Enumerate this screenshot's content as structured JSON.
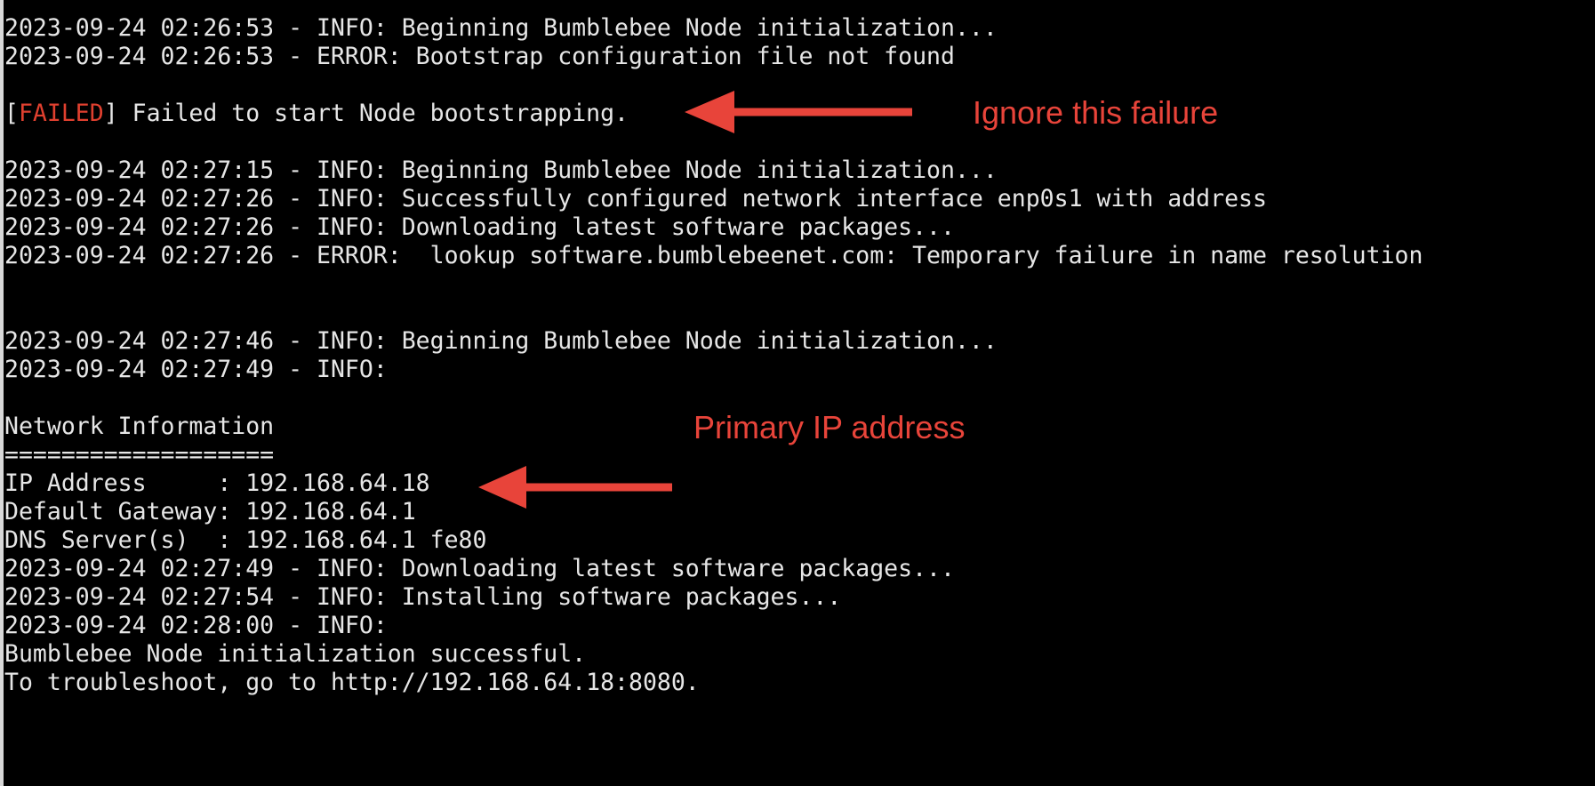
{
  "terminal": {
    "lines": [
      "2023-09-24 02:26:53 - INFO: Beginning Bumblebee Node initialization...",
      "2023-09-24 02:26:53 - ERROR: Bootstrap configuration file not found",
      "",
      "[FAILED] Failed to start Node bootstrapping.",
      "",
      "2023-09-24 02:27:15 - INFO: Beginning Bumblebee Node initialization...",
      "2023-09-24 02:27:26 - INFO: Successfully configured network interface enp0s1 with address",
      "2023-09-24 02:27:26 - INFO: Downloading latest software packages...",
      "2023-09-24 02:27:26 - ERROR:  lookup software.bumblebeenet.com: Temporary failure in name resolution",
      "",
      "",
      "2023-09-24 02:27:46 - INFO: Beginning Bumblebee Node initialization...",
      "2023-09-24 02:27:49 - INFO:",
      "",
      "Network Information",
      "===================",
      "IP Address     : 192.168.64.18",
      "Default Gateway: 192.168.64.1",
      "DNS Server(s)  : 192.168.64.1 fe80",
      "2023-09-24 02:27:49 - INFO: Downloading latest software packages...",
      "2023-09-24 02:27:54 - INFO: Installing software packages...",
      "2023-09-24 02:28:00 - INFO:",
      "Bumblebee Node initialization successful.",
      "To troubleshoot, go to http://192.168.64.18:8080."
    ],
    "failed_line": {
      "open_bracket": "[",
      "tag": "FAILED",
      "rest": "] Failed to start Node bootstrapping."
    }
  },
  "annotations": {
    "ignore_failure": "Ignore this failure",
    "primary_ip": "Primary IP address"
  },
  "colors": {
    "background": "#000000",
    "text": "#e6e6e6",
    "failed_tag": "#e0402f",
    "annotation": "#e8443a"
  }
}
